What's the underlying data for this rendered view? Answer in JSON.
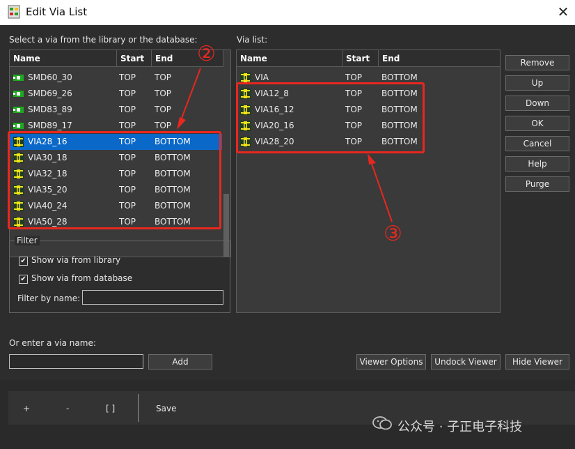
{
  "window": {
    "title": "Edit Via List",
    "close_icon": "close-icon"
  },
  "library": {
    "label": "Select a via from the library or the database:",
    "columns": [
      "Name",
      "Start",
      "End"
    ],
    "rows": [
      {
        "name": "SMD60_30",
        "start": "TOP",
        "end": "TOP",
        "icon": "smd-pad-icon"
      },
      {
        "name": "SMD69_26",
        "start": "TOP",
        "end": "TOP",
        "icon": "smd-pad-icon"
      },
      {
        "name": "SMD83_89",
        "start": "TOP",
        "end": "TOP",
        "icon": "smd-pad-icon"
      },
      {
        "name": "SMD89_17",
        "start": "TOP",
        "end": "TOP",
        "icon": "smd-pad-icon"
      },
      {
        "name": "VIA28_16",
        "start": "TOP",
        "end": "BOTTOM",
        "icon": "via-icon",
        "selected": true
      },
      {
        "name": "VIA30_18",
        "start": "TOP",
        "end": "BOTTOM",
        "icon": "via-icon"
      },
      {
        "name": "VIA32_18",
        "start": "TOP",
        "end": "BOTTOM",
        "icon": "via-icon"
      },
      {
        "name": "VIA35_20",
        "start": "TOP",
        "end": "BOTTOM",
        "icon": "via-icon"
      },
      {
        "name": "VIA40_24",
        "start": "TOP",
        "end": "BOTTOM",
        "icon": "via-icon"
      },
      {
        "name": "VIA50_28",
        "start": "TOP",
        "end": "BOTTOM",
        "icon": "via-icon"
      }
    ]
  },
  "filter": {
    "group_label": "Filter",
    "show_library": "Show via from library",
    "show_database": "Show via from database",
    "by_name_label": "Filter by name:",
    "by_name_value": ""
  },
  "enter": {
    "label": "Or enter a via name:",
    "value": "",
    "add_label": "Add"
  },
  "via_list": {
    "label": "Via list:",
    "columns": [
      "Name",
      "Start",
      "End"
    ],
    "rows": [
      {
        "name": "VIA",
        "start": "TOP",
        "end": "BOTTOM"
      },
      {
        "name": "VIA12_8",
        "start": "TOP",
        "end": "BOTTOM"
      },
      {
        "name": "VIA16_12",
        "start": "TOP",
        "end": "BOTTOM"
      },
      {
        "name": "VIA20_16",
        "start": "TOP",
        "end": "BOTTOM"
      },
      {
        "name": "VIA28_20",
        "start": "TOP",
        "end": "BOTTOM"
      }
    ]
  },
  "side_buttons": [
    "Remove",
    "Up",
    "Down",
    "OK",
    "Cancel",
    "Help",
    "Purge"
  ],
  "viewer_buttons": [
    "Viewer Options",
    "Undock Viewer",
    "Hide Viewer"
  ],
  "toolbar": {
    "plus": "+",
    "minus": "-",
    "brackets": "[ ]",
    "save": "Save"
  },
  "annotations": {
    "callout_2": "②",
    "callout_3": "③"
  },
  "watermark": "公众号 · 子正电子科技",
  "colors": {
    "selection": "#0a68c8",
    "annotation": "#e8271f",
    "via_icon": "#f5e21a",
    "smd_icon": "#1fa81f"
  }
}
